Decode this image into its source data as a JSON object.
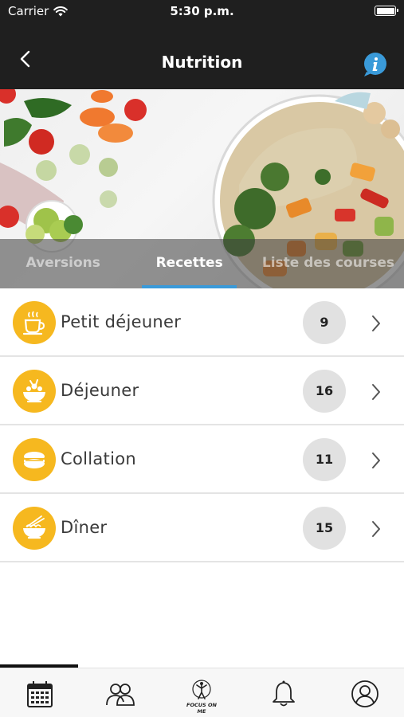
{
  "status": {
    "carrier": "Carrier",
    "time": "5:30 p.m."
  },
  "header": {
    "title": "Nutrition",
    "back_icon": "chevron-left-icon",
    "info_icon": "info-icon"
  },
  "colors": {
    "accent": "#3a9ad9",
    "icon_bg": "#f6b81f",
    "badge_bg": "#e1e1e1",
    "bar_bg": "#1f1f1f"
  },
  "tabs": [
    {
      "label": "Aversions",
      "active": false
    },
    {
      "label": "Recettes",
      "active": true
    },
    {
      "label": "Liste des courses",
      "active": false
    }
  ],
  "categories": [
    {
      "label": "Petit déjeuner",
      "count": "9",
      "icon": "coffee-cup-icon"
    },
    {
      "label": "Déjeuner",
      "count": "16",
      "icon": "salad-bowl-icon"
    },
    {
      "label": "Collation",
      "count": "11",
      "icon": "snack-icon"
    },
    {
      "label": "Dîner",
      "count": "15",
      "icon": "noodle-bowl-icon"
    }
  ],
  "tabbar": {
    "items": [
      "calendar-icon",
      "group-icon",
      "focus-on-me-logo",
      "bell-icon",
      "profile-icon"
    ],
    "logo_text": "FOCUS ON ME"
  }
}
